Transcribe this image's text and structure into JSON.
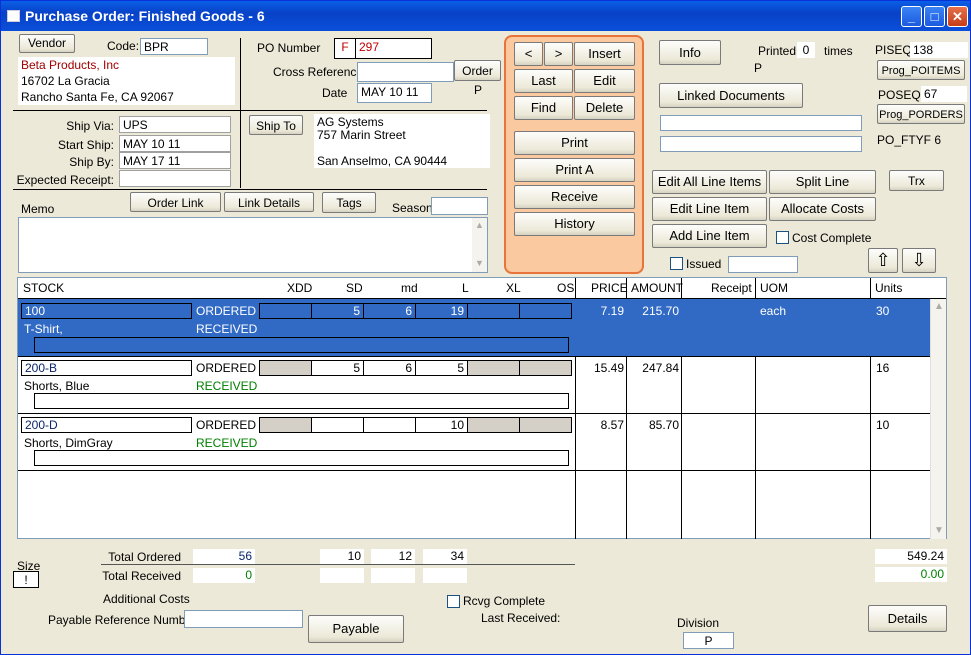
{
  "window": {
    "title": "Purchase Order: Finished Goods - 6",
    "min": "_",
    "max": "□",
    "close": "✕"
  },
  "vendor": {
    "button": "Vendor",
    "code_label": "Code:",
    "code": "BPR",
    "name": "Beta Products, Inc",
    "street": "16702 La Gracia",
    "city": "Rancho Santa Fe, CA 92067"
  },
  "po": {
    "number_label": "PO Number",
    "prefix": "F",
    "number": "297",
    "cross_ref_label": "Cross Reference",
    "cross_ref": "",
    "order_button": "Order",
    "order_flag": "P",
    "date_label": "Date",
    "date": "MAY 10 11"
  },
  "ship": {
    "via_label": "Ship Via:",
    "via": "UPS",
    "start_label": "Start Ship:",
    "start": "MAY 10 11",
    "by_label": "Ship By:",
    "by": "MAY 17 11",
    "expected_label": "Expected Receipt:",
    "expected": "",
    "shipto_button": "Ship To",
    "shipto_name": "AG Systems",
    "shipto_street": "757 Marin Street",
    "shipto_city": "San Anselmo, CA 90444"
  },
  "memo": {
    "label": "Memo",
    "order_link": "Order Link",
    "link_details": "Link Details",
    "tags": "Tags",
    "season_label": "Season",
    "season": "",
    "text": ""
  },
  "nav": {
    "prev": "<",
    "next": ">",
    "insert": "Insert",
    "last": "Last",
    "edit": "Edit",
    "find": "Find",
    "delete": "Delete",
    "print": "Print",
    "print_a": "Print A",
    "receive": "Receive",
    "history": "History"
  },
  "info": {
    "info_button": "Info",
    "printed_label": "Printed",
    "printed_count": "0",
    "times_label": "times",
    "printed_flag": "P",
    "linked_docs": "Linked Documents",
    "linked_1": "",
    "linked_2": ""
  },
  "right": {
    "piseq_label": "PISEQ",
    "piseq": "138",
    "prog_poitems": "Prog_POITEMS",
    "poseq_label": "POSEQ",
    "poseq": "67",
    "prog_porders": "Prog_PORDERS",
    "po_ftyf": "PO_FTYF 6"
  },
  "actions": {
    "edit_all": "Edit All Line Items",
    "split": "Split Line",
    "trx": "Trx",
    "edit_line": "Edit Line Item",
    "allocate": "Allocate Costs",
    "add_line": "Add Line Item",
    "cost_complete": "Cost Complete",
    "issued": "Issued",
    "issued_value": "",
    "up": "⇧",
    "down": "⇩"
  },
  "grid": {
    "headers": {
      "stock": "STOCK",
      "xdd": "XDD",
      "sd": "SD",
      "md": "md",
      "l": "L",
      "xl": "XL",
      "os": "OS",
      "price": "PRICE",
      "amount": "AMOUNT",
      "receipt": "Receipt",
      "uom": "UOM",
      "units": "Units"
    },
    "rows": [
      {
        "stock": "100",
        "desc": "T-Shirt,",
        "ordered": "ORDERED",
        "received": "RECEIVED",
        "xdd": "",
        "sd": "5",
        "md": "6",
        "l": "19",
        "xl": "",
        "os": "",
        "price": "7.19",
        "amount": "215.70",
        "receipt": "",
        "uom": "each",
        "units": "30"
      },
      {
        "stock": "200-B",
        "desc": "Shorts, Blue",
        "ordered": "ORDERED",
        "received": "RECEIVED",
        "xdd": "",
        "sd": "5",
        "md": "6",
        "l": "5",
        "xl": "",
        "os": "",
        "price": "15.49",
        "amount": "247.84",
        "receipt": "",
        "uom": "",
        "units": "16"
      },
      {
        "stock": "200-D",
        "desc": "Shorts, DimGray",
        "ordered": "ORDERED",
        "received": "RECEIVED",
        "xdd": "",
        "sd": "",
        "md": "",
        "l": "10",
        "xl": "",
        "os": "",
        "price": "8.57",
        "amount": "85.70",
        "receipt": "",
        "uom": "",
        "units": "10"
      }
    ]
  },
  "totals": {
    "size_label": "Size",
    "size_value": "!",
    "ordered_label": "Total Ordered",
    "ordered": "56",
    "ord_sd": "10",
    "ord_md": "12",
    "ord_l": "34",
    "received_label": "Total Received",
    "received": "0",
    "add_costs_label": "Additional Costs",
    "payable_ref_label": "Payable Reference Number",
    "payable_ref": "",
    "payable_button": "Payable",
    "rcvg_complete": "Rcvg Complete",
    "last_received_label": "Last Received:",
    "division_label": "Division",
    "division": "P",
    "total_amount": "549.24",
    "received_amount": "0.00",
    "details_button": "Details"
  }
}
